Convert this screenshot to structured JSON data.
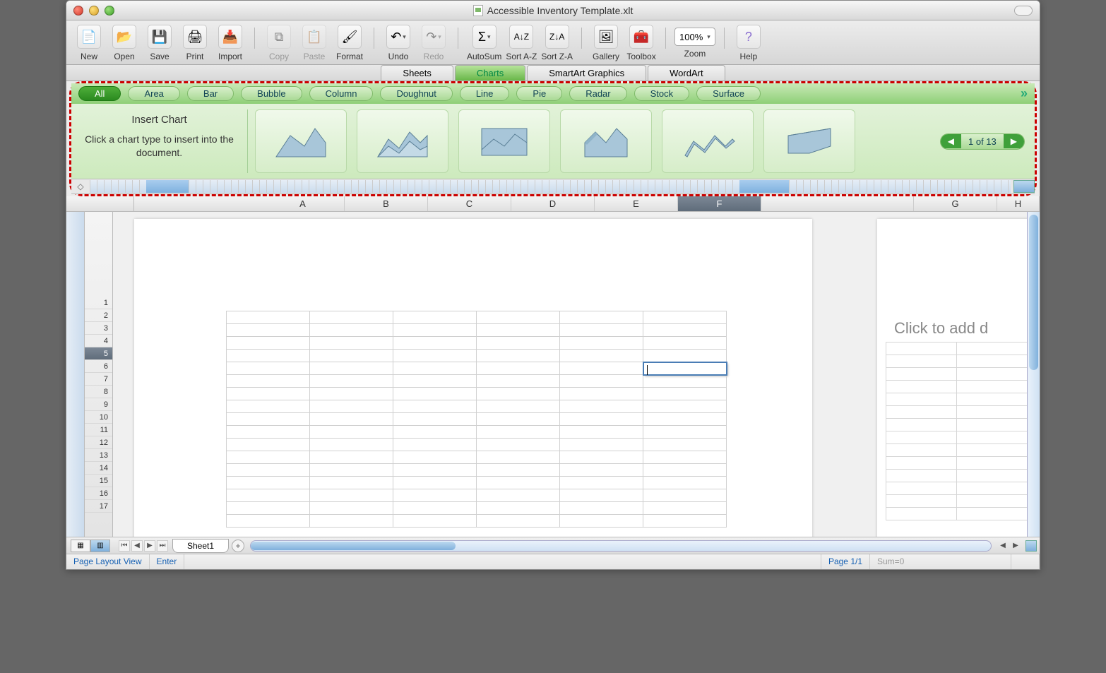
{
  "window": {
    "title": "Accessible Inventory Template.xlt"
  },
  "toolbar": {
    "new": "New",
    "open": "Open",
    "save": "Save",
    "print": "Print",
    "import": "Import",
    "copy": "Copy",
    "paste": "Paste",
    "format": "Format",
    "undo": "Undo",
    "redo": "Redo",
    "autosum": "AutoSum",
    "sortAZ": "Sort A-Z",
    "sortZA": "Sort Z-A",
    "gallery": "Gallery",
    "toolbox": "Toolbox",
    "zoom_label": "Zoom",
    "zoom_value": "100%",
    "help": "Help"
  },
  "doctabs": [
    "Sheets",
    "Charts",
    "SmartArt Graphics",
    "WordArt"
  ],
  "doctabs_active": 1,
  "chart_categories": [
    "All",
    "Area",
    "Bar",
    "Bubble",
    "Column",
    "Doughnut",
    "Line",
    "Pie",
    "Radar",
    "Stock",
    "Surface"
  ],
  "chart_categories_active": 0,
  "gallery_panel": {
    "header": "Insert Chart",
    "hint": "Click a chart type to insert into the document.",
    "pager": "1 of 13"
  },
  "columns": [
    "A",
    "B",
    "C",
    "D",
    "E",
    "F",
    "G",
    "H"
  ],
  "selected_column_index": 5,
  "rows": [
    1,
    2,
    3,
    4,
    5,
    6,
    7,
    8,
    9,
    10,
    11,
    12,
    13,
    14,
    15,
    16,
    17
  ],
  "selected_row": 5,
  "placeholder_right": "Click to add d",
  "sheet": {
    "name": "Sheet1"
  },
  "status": {
    "view": "Page Layout View",
    "mode": "Enter",
    "page": "Page 1/1",
    "sum": "Sum=0"
  }
}
